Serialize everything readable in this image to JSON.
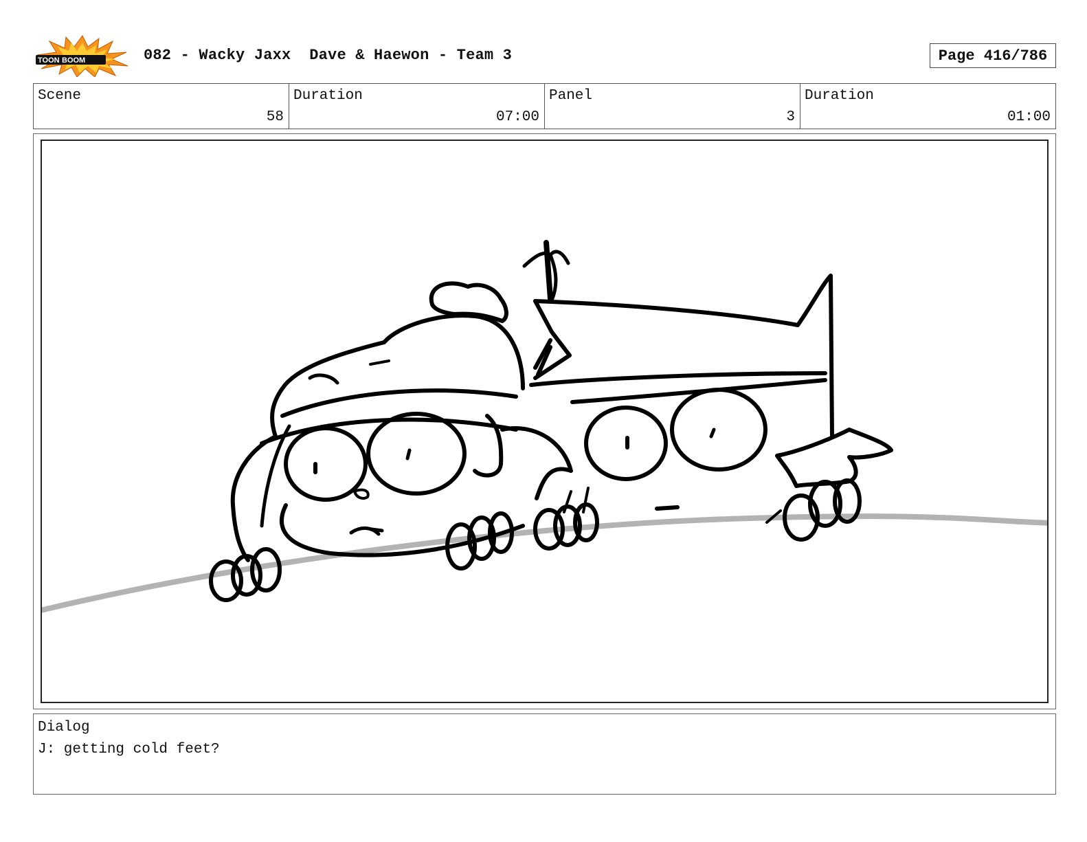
{
  "header": {
    "logo_text": "TOON BOOM",
    "title": "082 - Wacky Jaxx  Dave & Haewon - Team 3",
    "page": "Page 416/786"
  },
  "info": {
    "scene_label": "Scene",
    "scene_value": "58",
    "scene_duration_label": "Duration",
    "scene_duration_value": "07:00",
    "panel_label": "Panel",
    "panel_value": "3",
    "panel_duration_label": "Duration",
    "panel_duration_value": "01:00"
  },
  "dialog": {
    "label": "Dialog",
    "text": "J: getting cold feet?"
  },
  "colors": {
    "logo_burst": "#f7941d",
    "logo_burst_inner": "#ffcc33",
    "ground_line": "#b3b3b3",
    "ink": "#000000"
  }
}
